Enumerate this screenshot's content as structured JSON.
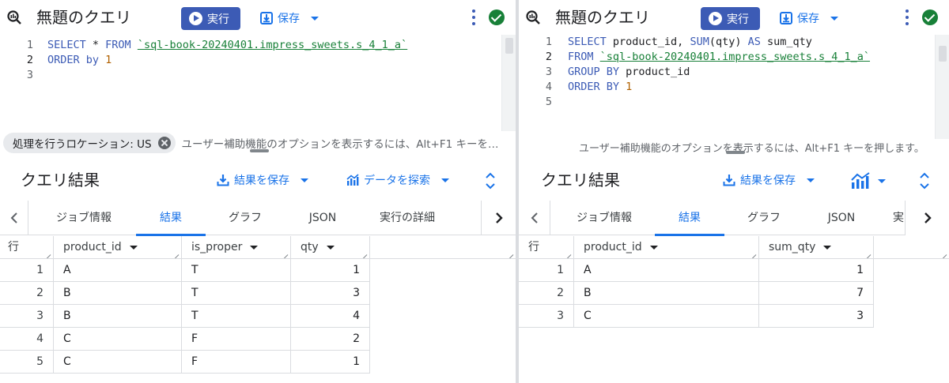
{
  "colors": {
    "accent": "#1a73e8",
    "run_button": "#3c5bb5",
    "success": "#188038",
    "keyword": "#3c5bb5",
    "string": "#188038",
    "number": "#b06000"
  },
  "left": {
    "title": "無題のクエリ",
    "run_label": "実行",
    "save_label": "保存",
    "code_lines": [
      "1",
      "2",
      "3"
    ],
    "code": {
      "l1_kw1": "SELECT",
      "l1_mid": " * ",
      "l1_kw2": "FROM",
      "l1_sp": " ",
      "l1_table": "`sql-book-20240401.impress_sweets.s_4_1_a`",
      "l2_kw": "ORDER by",
      "l2_sp": " ",
      "l2_num": "1"
    },
    "location_chip": "処理を行うロケーション: US",
    "a11y_hint": "ユーザー補助機能のオプションを表示するには、Alt+F1 キーを…",
    "results_title": "クエリ結果",
    "save_results_label": "結果を保存",
    "explore_label": "データを探索",
    "tabs": [
      "ジョブ情報",
      "結果",
      "グラフ",
      "JSON",
      "実行の詳細"
    ],
    "active_tab": "結果",
    "table": {
      "headers": [
        "行",
        "product_id",
        "is_proper",
        "qty"
      ],
      "rows": [
        [
          "1",
          "A",
          "T",
          "1"
        ],
        [
          "2",
          "B",
          "T",
          "3"
        ],
        [
          "3",
          "B",
          "T",
          "4"
        ],
        [
          "4",
          "C",
          "F",
          "2"
        ],
        [
          "5",
          "C",
          "F",
          "1"
        ]
      ]
    }
  },
  "right": {
    "title": "無題のクエリ",
    "run_label": "実行",
    "save_label": "保存",
    "code_lines": [
      "1",
      "2",
      "3",
      "4",
      "5"
    ],
    "code": {
      "l1_kw1": "SELECT",
      "l1_a": " product_id, ",
      "l1_fn": "SUM",
      "l1_b": "(qty) ",
      "l1_kw2": "AS",
      "l1_c": " sum_qty",
      "l2_kw": "FROM",
      "l2_sp": " ",
      "l2_table": "`sql-book-20240401.impress_sweets.s_4_1_a`",
      "l3_kw": "GROUP BY",
      "l3_rest": " product_id",
      "l4_kw": "ORDER BY",
      "l4_sp": " ",
      "l4_num": "1"
    },
    "a11y_hint": "ユーザー補助機能のオプションを表示するには、Alt+F1 キーを押します。",
    "results_title": "クエリ結果",
    "save_results_label": "結果を保存",
    "tabs": [
      "ジョブ情報",
      "結果",
      "グラフ",
      "JSON",
      "実"
    ],
    "active_tab": "結果",
    "table": {
      "headers": [
        "行",
        "product_id",
        "sum_qty"
      ],
      "rows": [
        [
          "1",
          "A",
          "1"
        ],
        [
          "2",
          "B",
          "7"
        ],
        [
          "3",
          "C",
          "3"
        ]
      ]
    }
  }
}
